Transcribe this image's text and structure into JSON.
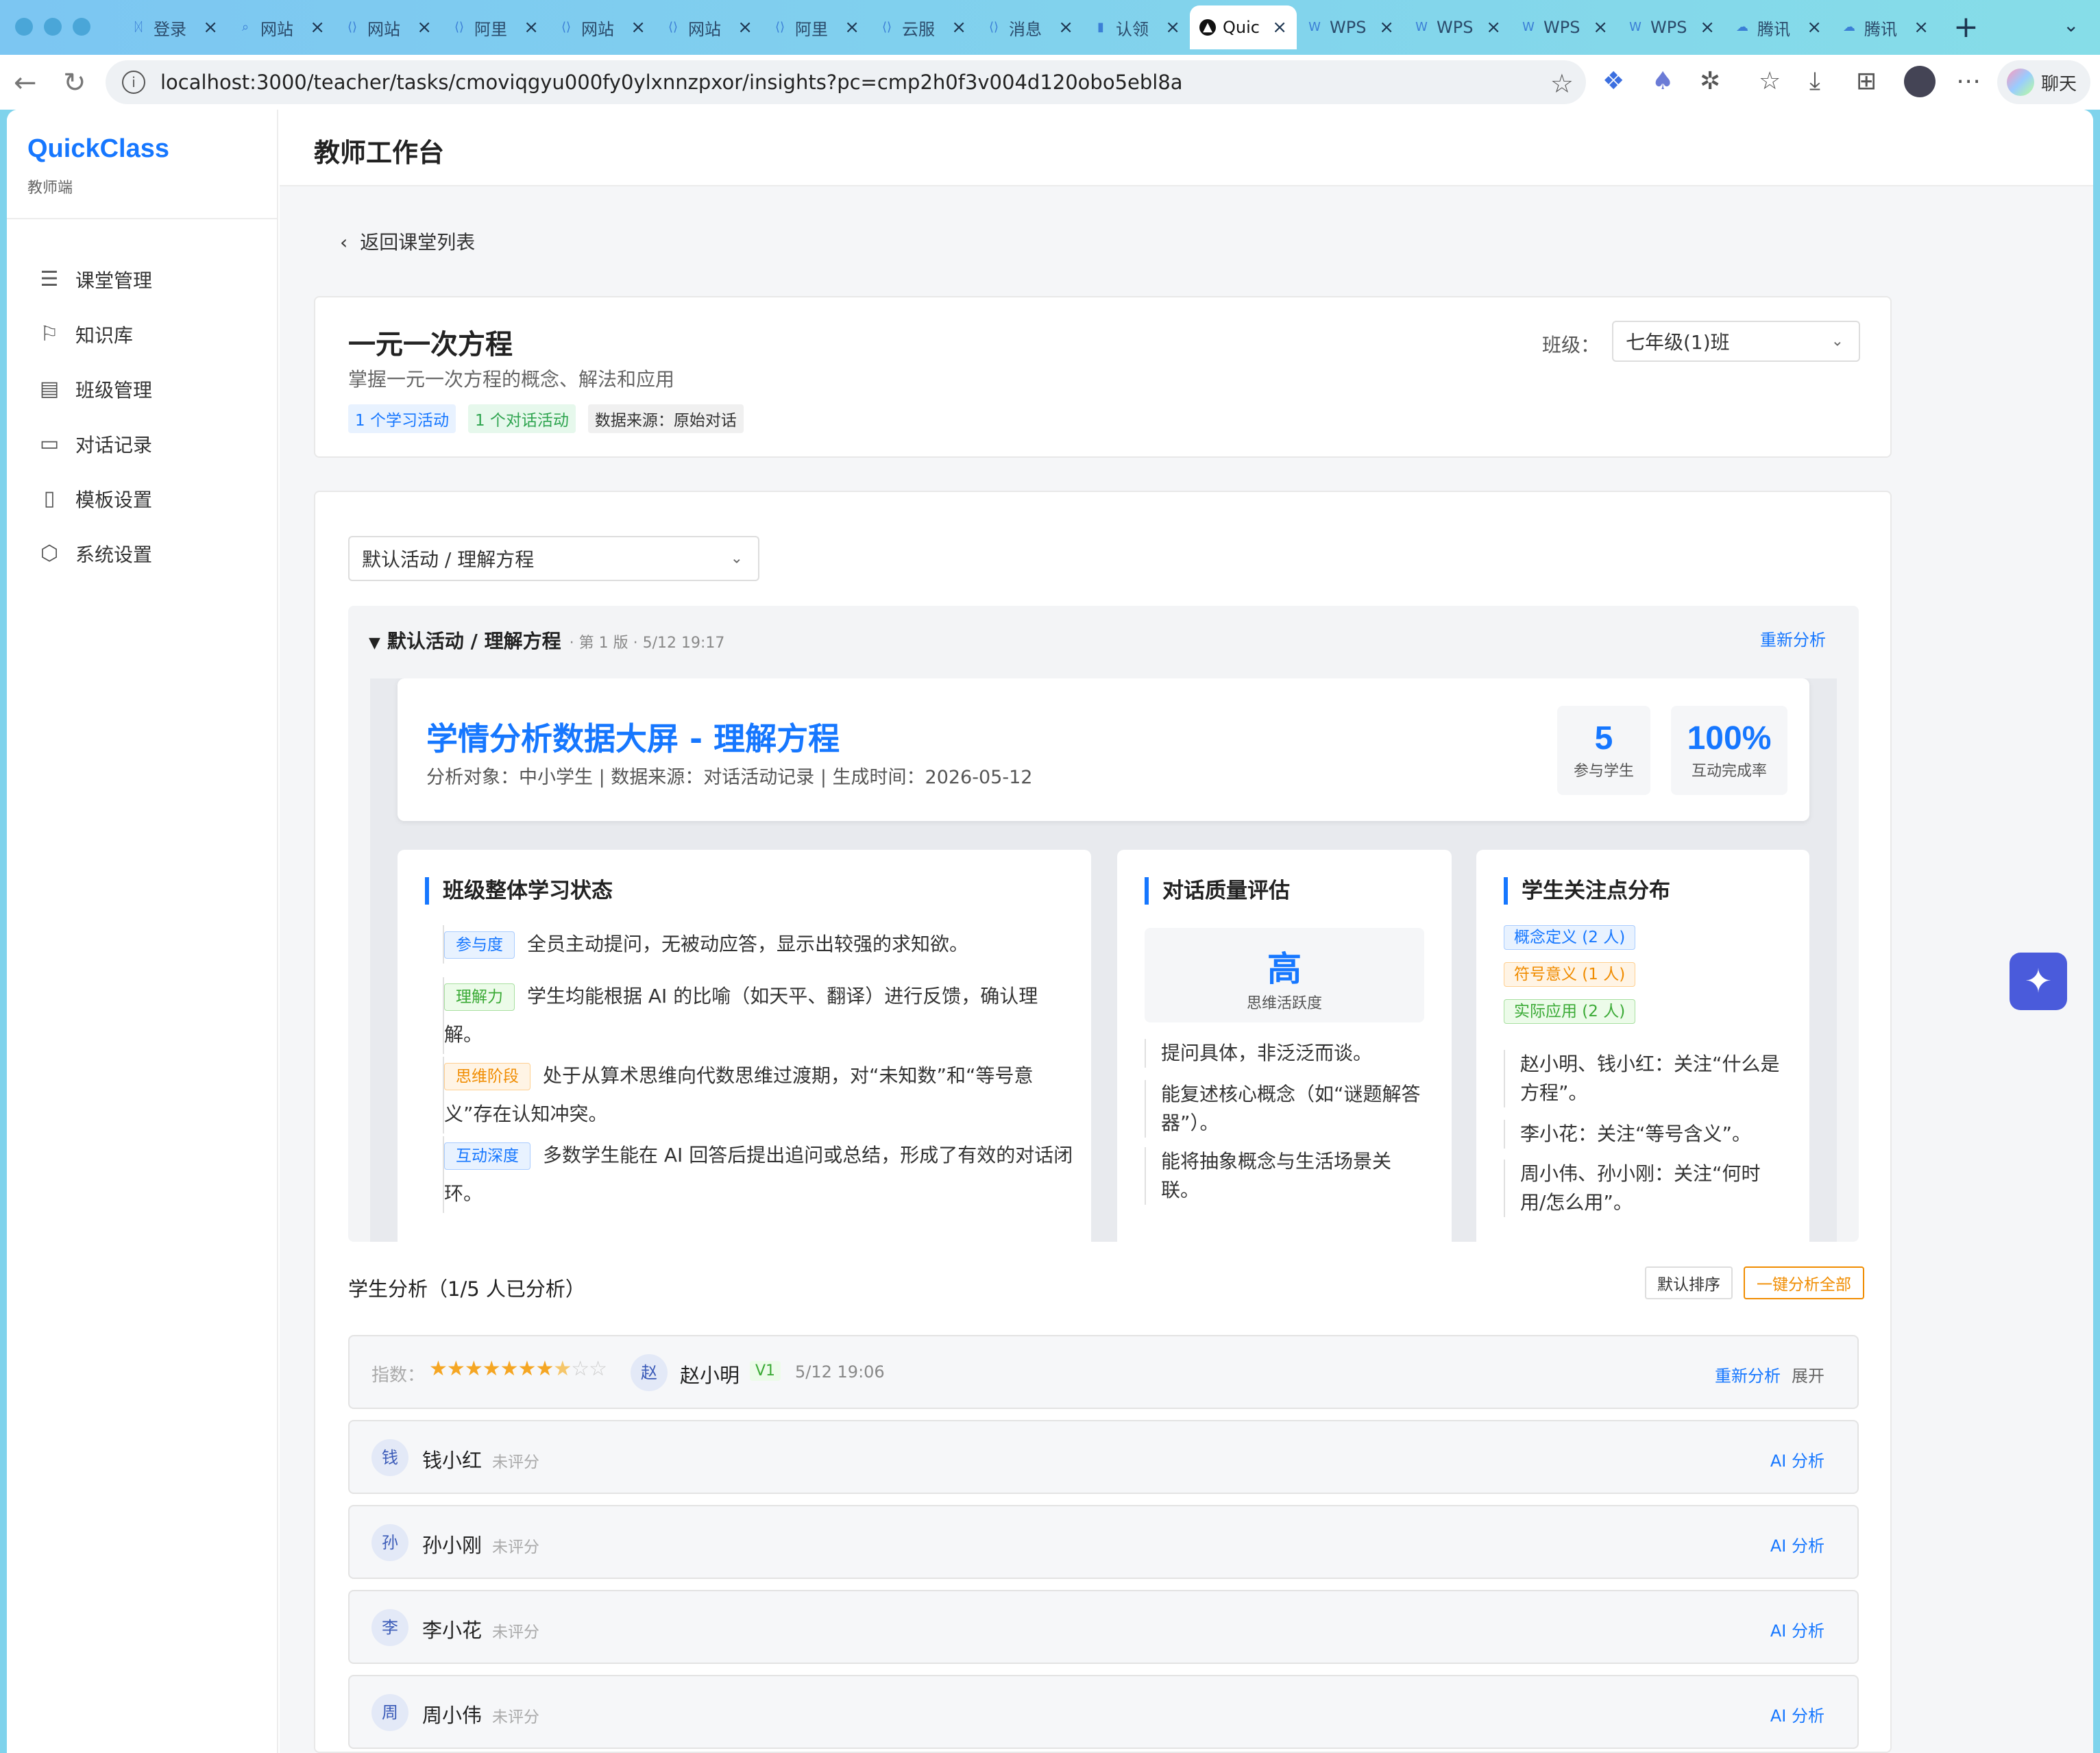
{
  "browser": {
    "tabs": [
      {
        "icon": "ᛞ",
        "title": "登录"
      },
      {
        "icon": "⌕",
        "title": "网站"
      },
      {
        "icon": "⟨⟩",
        "title": "网站"
      },
      {
        "icon": "⟨⟩",
        "title": "阿里"
      },
      {
        "icon": "⟨⟩",
        "title": "网站"
      },
      {
        "icon": "⟨⟩",
        "title": "网站"
      },
      {
        "icon": "⟨⟩",
        "title": "阿里"
      },
      {
        "icon": "⟨⟩",
        "title": "云服"
      },
      {
        "icon": "⟨⟩",
        "title": "消息"
      },
      {
        "icon": "▮",
        "title": "认领"
      },
      {
        "icon": "▲",
        "title": "Quic",
        "active": true
      },
      {
        "icon": "W",
        "title": "WPS"
      },
      {
        "icon": "W",
        "title": "WPS"
      },
      {
        "icon": "W",
        "title": "WPS"
      },
      {
        "icon": "W",
        "title": "WPS"
      },
      {
        "icon": "☁",
        "title": "腾讯"
      },
      {
        "icon": "☁",
        "title": "腾讯"
      }
    ],
    "url": "localhost:3000/teacher/tasks/cmoviqgyu000fy0ylxnnzpxor/insights?pc=cmp2h0f3v004d120obo5ebl8a",
    "chat_label": "聊天"
  },
  "sidebar": {
    "brand": "QuickClass",
    "brand_sub": "教师端",
    "items": [
      {
        "label": "课堂管理",
        "icon": "menu-icon"
      },
      {
        "label": "知识库",
        "icon": "bookmark-icon"
      },
      {
        "label": "班级管理",
        "icon": "list-icon"
      },
      {
        "label": "对话记录",
        "icon": "chat-icon"
      },
      {
        "label": "模板设置",
        "icon": "file-icon"
      },
      {
        "label": "系统设置",
        "icon": "settings-icon"
      }
    ]
  },
  "header": {
    "title": "教师工作台"
  },
  "back_label": "返回课堂列表",
  "lesson": {
    "title": "一元一次方程",
    "subtitle": "掌握一元一次方程的概念、解法和应用",
    "tags": [
      "1 个学习活动",
      "1 个对话活动",
      "数据来源：原始对话"
    ],
    "class_label": "班级：",
    "class_value": "七年级(1)班"
  },
  "activity_select": "默认活动 / 理解方程",
  "analysis": {
    "head": "默认活动 / 理解方程",
    "meta": "· 第 1 版 · 5/12 19:17",
    "reanalyze": "重新分析",
    "dash_title": "学情分析数据大屏 - 理解方程",
    "dash_sub": "分析对象：中小学生 | 数据来源：对话活动记录 | 生成时间：2026-05-12",
    "stats": [
      {
        "value": "5",
        "label": "参与学生"
      },
      {
        "value": "100%",
        "label": "互动完成率"
      }
    ],
    "overall": {
      "title": "班级整体学习状态",
      "rows": [
        {
          "tag": "参与度",
          "color": "blue",
          "text": "全员主动提问，无被动应答，显示出较强的求知欲。"
        },
        {
          "tag": "理解力",
          "color": "green",
          "text": "学生均能根据 AI 的比喻（如天平、翻译）进行反馈，确认理解。"
        },
        {
          "tag": "思维阶段",
          "color": "orange",
          "text": "处于从算术思维向代数思维过渡期，对“未知数”和“等号意义”存在认知冲突。"
        },
        {
          "tag": "互动深度",
          "color": "blue",
          "text": "多数学生能在 AI 回答后提出追问或总结，形成了有效的对话闭环。"
        }
      ]
    },
    "quality": {
      "title": "对话质量评估",
      "level": "高",
      "level_label": "思维活跃度",
      "items": [
        "提问具体，非泛泛而谈。",
        "能复述核心概念（如“谜题解答器”）。",
        "能将抽象概念与生活场景关联。"
      ]
    },
    "focus": {
      "title": "学生关注点分布",
      "tags": [
        {
          "label": "概念定义 (2 人)",
          "color": "blue"
        },
        {
          "label": "符号意义 (1 人)",
          "color": "orange"
        },
        {
          "label": "实际应用 (2 人)",
          "color": "green"
        }
      ],
      "items": [
        "赵小明、钱小红：关注“什么是方程”。",
        "李小花：关注“等号含义”。",
        "周小伟、孙小刚：关注“何时用/怎么用”。"
      ]
    }
  },
  "students": {
    "title": "学生分析（1/5 人已分析）",
    "sort_label": "默认排序",
    "analyze_all": "一键分析全部",
    "first": {
      "index_label": "指数：",
      "rating": 7.5,
      "rating_max": 10,
      "avatar": "赵",
      "name": "赵小明",
      "version": "V1",
      "time": "5/12 19:06",
      "reanalyze": "重新分析",
      "expand": "展开"
    },
    "others": [
      {
        "avatar": "钱",
        "name": "钱小红",
        "status": "未评分",
        "action": "AI 分析"
      },
      {
        "avatar": "孙",
        "name": "孙小刚",
        "status": "未评分",
        "action": "AI 分析"
      },
      {
        "avatar": "李",
        "name": "李小花",
        "status": "未评分",
        "action": "AI 分析"
      },
      {
        "avatar": "周",
        "name": "周小伟",
        "status": "未评分",
        "action": "AI 分析"
      }
    ]
  },
  "colors": {
    "accent": "#1677ff",
    "orange": "#f08c00",
    "green": "#2ea44f"
  }
}
